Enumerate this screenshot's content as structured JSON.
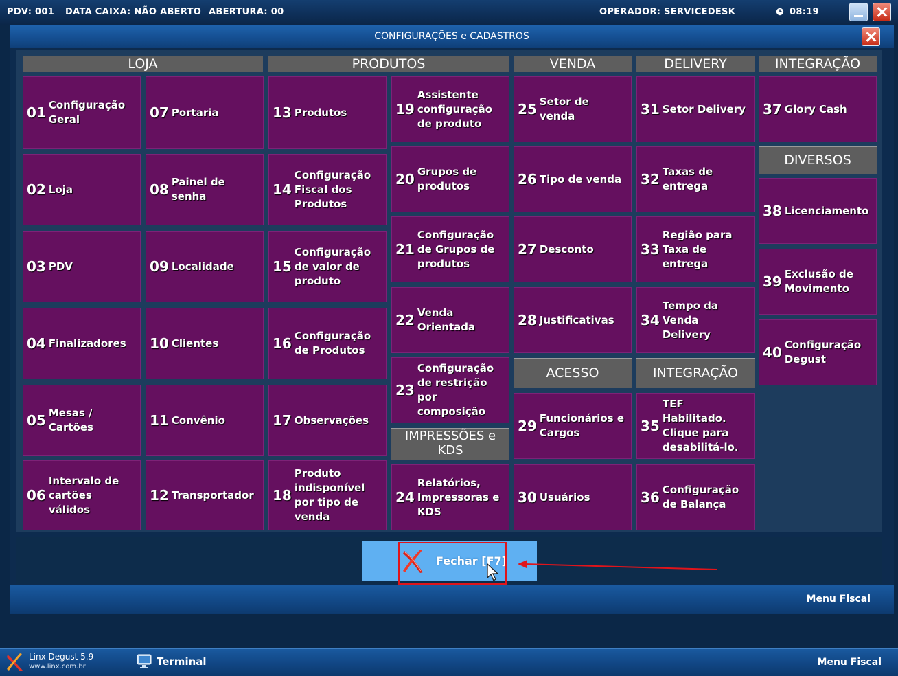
{
  "status_bar": {
    "pdv": "PDV: 001",
    "data_caixa": "DATA CAIXA: NÃO ABERTO",
    "abertura": "ABERTURA: 00",
    "operador": "OPERADOR: SERVICEDESK",
    "time": "08:19",
    "clock_icon": "clock-icon",
    "minimize_icon": "minimize-icon",
    "close_icon": "close-icon"
  },
  "dialog": {
    "title": "CONFIGURAÇÕES e CADASTROS",
    "footer": "Menu Fiscal"
  },
  "headers": {
    "loja": "LOJA",
    "produtos": "PRODUTOS",
    "venda": "VENDA",
    "delivery": "DELIVERY",
    "integracao_top": "INTEGRAÇÃO",
    "diversos": "DIVERSOS",
    "acesso": "ACESSO",
    "integracao_bottom": "INTEGRAÇÃO",
    "impressoes_kds": "IMPRESSÕES e\nKDS"
  },
  "tiles": {
    "t01": {
      "num": "01",
      "label": "Configuração\nGeral"
    },
    "t02": {
      "num": "02",
      "label": "Loja"
    },
    "t03": {
      "num": "03",
      "label": "PDV"
    },
    "t04": {
      "num": "04",
      "label": "Finalizadores"
    },
    "t05": {
      "num": "05",
      "label": "Mesas /\nCartões"
    },
    "t06": {
      "num": "06",
      "label": "Intervalo de\ncartões\nválidos"
    },
    "t07": {
      "num": "07",
      "label": "Portaria"
    },
    "t08": {
      "num": "08",
      "label": "Painel de\nsenha"
    },
    "t09": {
      "num": "09",
      "label": "Localidade"
    },
    "t10": {
      "num": "10",
      "label": "Clientes"
    },
    "t11": {
      "num": "11",
      "label": "Convênio"
    },
    "t12": {
      "num": "12",
      "label": "Transportador"
    },
    "t13": {
      "num": "13",
      "label": "Produtos"
    },
    "t14": {
      "num": "14",
      "label": "Configuração\nFiscal dos\nProdutos"
    },
    "t15": {
      "num": "15",
      "label": "Configuração\nde valor de\nproduto"
    },
    "t16": {
      "num": "16",
      "label": "Configuração\nde Produtos"
    },
    "t17": {
      "num": "17",
      "label": "Observações"
    },
    "t18": {
      "num": "18",
      "label": "Produto\nindisponível\npor tipo de\nvenda"
    },
    "t19": {
      "num": "19",
      "label": "Assistente\nconfiguração\nde produto"
    },
    "t20": {
      "num": "20",
      "label": "Grupos de\nprodutos"
    },
    "t21": {
      "num": "21",
      "label": "Configuração\nde Grupos de\nprodutos"
    },
    "t22": {
      "num": "22",
      "label": "Venda\nOrientada"
    },
    "t23": {
      "num": "23",
      "label": "Configuração\nde restrição\npor\ncomposição"
    },
    "t24": {
      "num": "24",
      "label": "Relatórios,\nImpressoras e\nKDS"
    },
    "t25": {
      "num": "25",
      "label": "Setor de\nvenda"
    },
    "t26": {
      "num": "26",
      "label": "Tipo de venda"
    },
    "t27": {
      "num": "27",
      "label": "Desconto"
    },
    "t28": {
      "num": "28",
      "label": "Justificativas"
    },
    "t29": {
      "num": "29",
      "label": "Funcionários e\nCargos"
    },
    "t30": {
      "num": "30",
      "label": "Usuários"
    },
    "t31": {
      "num": "31",
      "label": "Setor Delivery"
    },
    "t32": {
      "num": "32",
      "label": "Taxas de\nentrega"
    },
    "t33": {
      "num": "33",
      "label": "Região para\nTaxa de\nentrega"
    },
    "t34": {
      "num": "34",
      "label": "Tempo da\nVenda\nDelivery"
    },
    "t35": {
      "num": "35",
      "label": "TEF\nHabilitado.\nClique para\ndesabilitá-lo."
    },
    "t36": {
      "num": "36",
      "label": "Configuração\nde Balança"
    },
    "t37": {
      "num": "37",
      "label": "Glory Cash"
    },
    "t38": {
      "num": "38",
      "label": "Licenciamento"
    },
    "t39": {
      "num": "39",
      "label": "Exclusão de\nMovimento"
    },
    "t40": {
      "num": "40",
      "label": "Configuração\nDegust"
    }
  },
  "close_button": {
    "label": "Fechar [F7]",
    "icon": "red-x-icon"
  },
  "annotation": {
    "color": "#e0141b",
    "arrow_icon": "red-arrow-icon"
  },
  "taskbar": {
    "app_name": "Linx Degust 5.9",
    "app_url": "www.linx.com.br",
    "terminal": "Terminal",
    "menu_fiscal": "Menu Fiscal",
    "logo_icon": "linx-logo-icon",
    "terminal_icon": "terminal-icon"
  },
  "colors": {
    "tile": "#65105f",
    "header": "#5e5e5e",
    "close_button": "#5fb0f2",
    "background": "#0b2747"
  }
}
